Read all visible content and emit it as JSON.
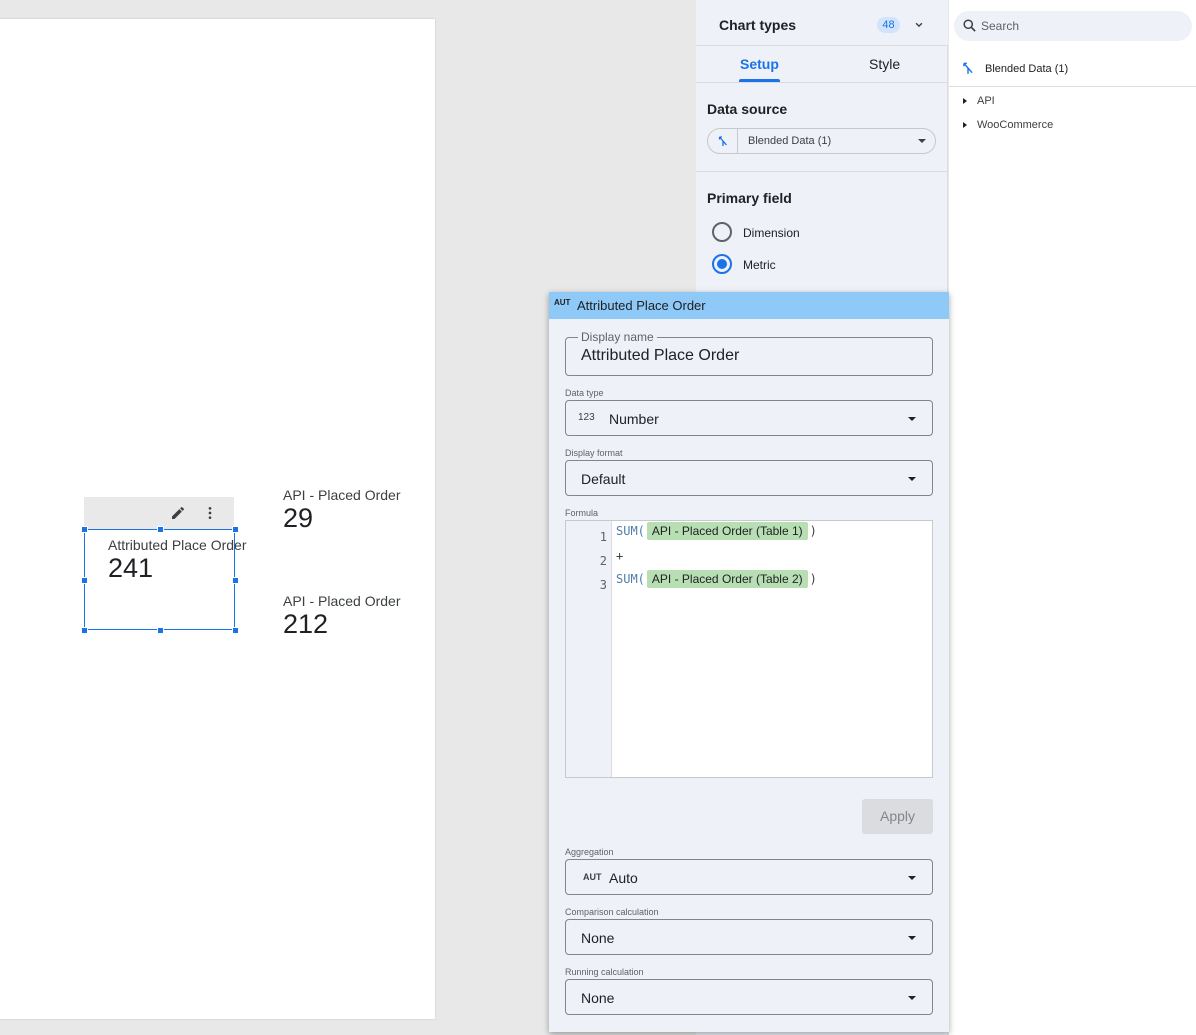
{
  "canvas": {
    "selected_scorecard": {
      "label": "Attributed Place Order",
      "value": "241"
    },
    "scorecards": [
      {
        "label": "API - Placed Order",
        "value": "29"
      },
      {
        "label": "API - Placed Order",
        "value": "212"
      }
    ]
  },
  "properties": {
    "chart_types_label": "Chart types",
    "chart_types_count": "48",
    "tabs": {
      "setup": "Setup",
      "style": "Style"
    },
    "data_source_title": "Data source",
    "data_source_value": "Blended Data (1)",
    "primary_field_title": "Primary field",
    "options": {
      "dimension": "Dimension",
      "metric": "Metric"
    },
    "selected": "Metric"
  },
  "data_panel": {
    "search_placeholder": "Search",
    "blended": "Blended Data (1)",
    "tree": [
      "API",
      "WooCommerce"
    ]
  },
  "editor": {
    "type_badge": "AUT",
    "title": "Attributed Place Order",
    "display_name_label": "Display name",
    "display_name_value": "Attributed Place Order",
    "data_type_label": "Data type",
    "data_type_icon": "123",
    "data_type_value": "Number",
    "display_format_label": "Display format",
    "display_format_value": "Default",
    "formula_label": "Formula",
    "formula": {
      "line_numbers": [
        "1",
        "2",
        "3"
      ],
      "fn": "SUM(",
      "close": ")",
      "operator": "+",
      "field_1": "API - Placed Order (Table 1)",
      "field_2": "API - Placed Order (Table 2)"
    },
    "apply_label": "Apply",
    "aggregation_label": "Aggregation",
    "aggregation_icon": "AUT",
    "aggregation_value": "Auto",
    "comparison_label": "Comparison calculation",
    "comparison_value": "None",
    "running_label": "Running calculation",
    "running_value": "None"
  }
}
